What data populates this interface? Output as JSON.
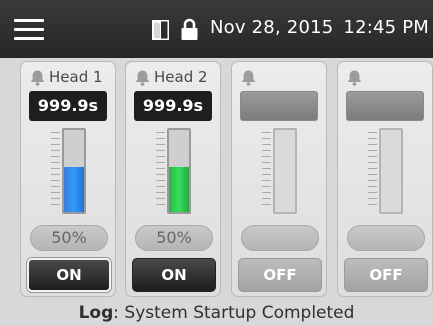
{
  "status_bar": {
    "date": "Nov 28, 2015",
    "time": "12:45 PM",
    "icons": [
      "menu-icon",
      "door-icon",
      "lock-icon"
    ]
  },
  "channels": [
    {
      "label": "Head 1",
      "timer": "999.9s",
      "percent": "50%",
      "level": 0.55,
      "fill_color": "#2f9bff",
      "state": "ON"
    },
    {
      "label": "Head 2",
      "timer": "999.9s",
      "percent": "50%",
      "level": 0.55,
      "fill_color": "#33e05a",
      "state": "ON"
    },
    {
      "label": "",
      "timer": "",
      "percent": "",
      "level": 0,
      "fill_color": "",
      "state": "OFF"
    },
    {
      "label": "",
      "timer": "",
      "percent": "",
      "level": 0,
      "fill_color": "",
      "state": "OFF"
    }
  ],
  "log": {
    "prefix": "Log",
    "separator": ": ",
    "message": "System Startup Completed"
  }
}
